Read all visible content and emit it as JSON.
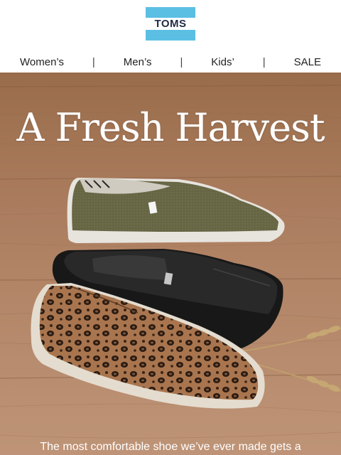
{
  "header": {
    "logo_text": "TOMS",
    "brand_color": "#5bbfe3"
  },
  "nav": {
    "items": [
      {
        "label": "Women’s"
      },
      {
        "label": "Men’s"
      },
      {
        "label": "Kids’"
      },
      {
        "label": "SALE"
      }
    ],
    "separator": "|"
  },
  "hero": {
    "title": "A Fresh Harvest",
    "caption": "The most comfortable shoe we’ve ever made gets a",
    "image": "three TOMS slip-on shoes (olive, black leather, leopard) on wood with wheat"
  }
}
